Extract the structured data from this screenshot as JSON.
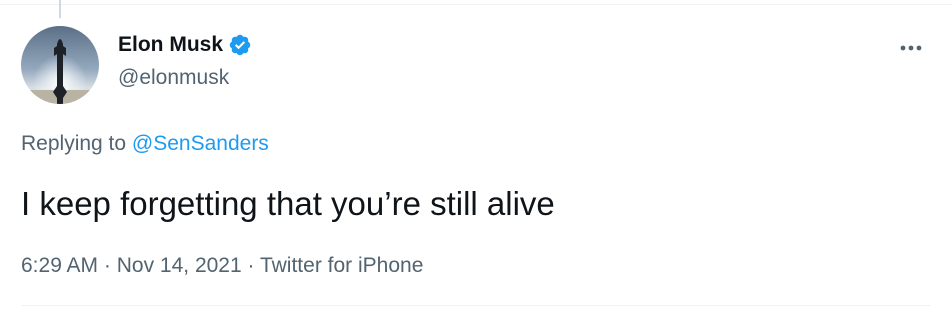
{
  "author": {
    "display_name": "Elon Musk",
    "handle": "@elonmusk",
    "verified": true,
    "avatar_icon": "starship-avatar"
  },
  "menu_icon": "more-horizontal-icon",
  "reply": {
    "prefix": "Replying to ",
    "mention": "@SenSanders"
  },
  "tweet": {
    "text": "I keep forgetting that you’re still alive"
  },
  "meta": {
    "time": "6:29 AM",
    "separator": " · ",
    "date": "Nov 14, 2021",
    "source": "Twitter for iPhone"
  },
  "colors": {
    "accent": "#1d9bf0",
    "text_primary": "#0f1419",
    "text_secondary": "#536471"
  }
}
